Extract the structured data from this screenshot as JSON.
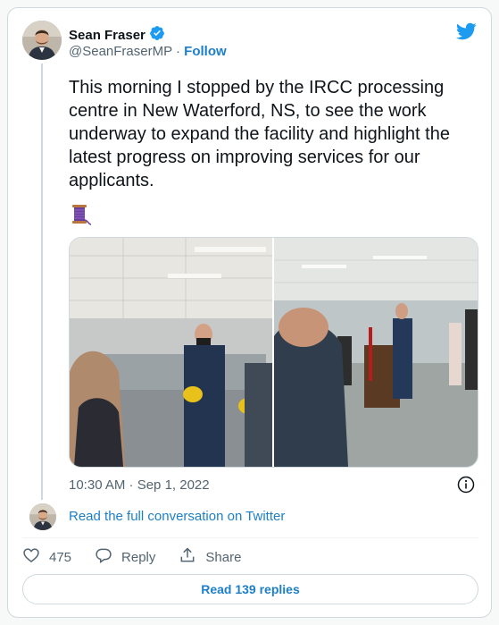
{
  "author": {
    "name": "Sean Fraser",
    "handle": "@SeanFraserMP",
    "separator": "·",
    "follow_label": "Follow",
    "verified_icon": "verified-badge-icon",
    "avatar": "author-avatar"
  },
  "tweet": {
    "text": "This morning I stopped by the IRCC processing centre in New Waterford, NS, to see the work underway to expand the facility and highlight the latest progress on improving services for our applicants.",
    "emoji_icon": "spool-of-thread-icon",
    "photos": [
      "processing-centre-photo-left",
      "processing-centre-photo-right"
    ],
    "timestamp": "10:30 AM · Sep 1, 2022"
  },
  "thread": {
    "read_full_label": "Read the full conversation on Twitter"
  },
  "actions": {
    "like_count": "475",
    "reply_label": "Reply",
    "share_label": "Share"
  },
  "footer": {
    "read_replies_label": "Read 139 replies"
  },
  "colors": {
    "brand_blue": "#1d9bf0",
    "link_blue": "#1d7fc8",
    "secondary_text": "#536471",
    "border": "#cfd9de"
  }
}
